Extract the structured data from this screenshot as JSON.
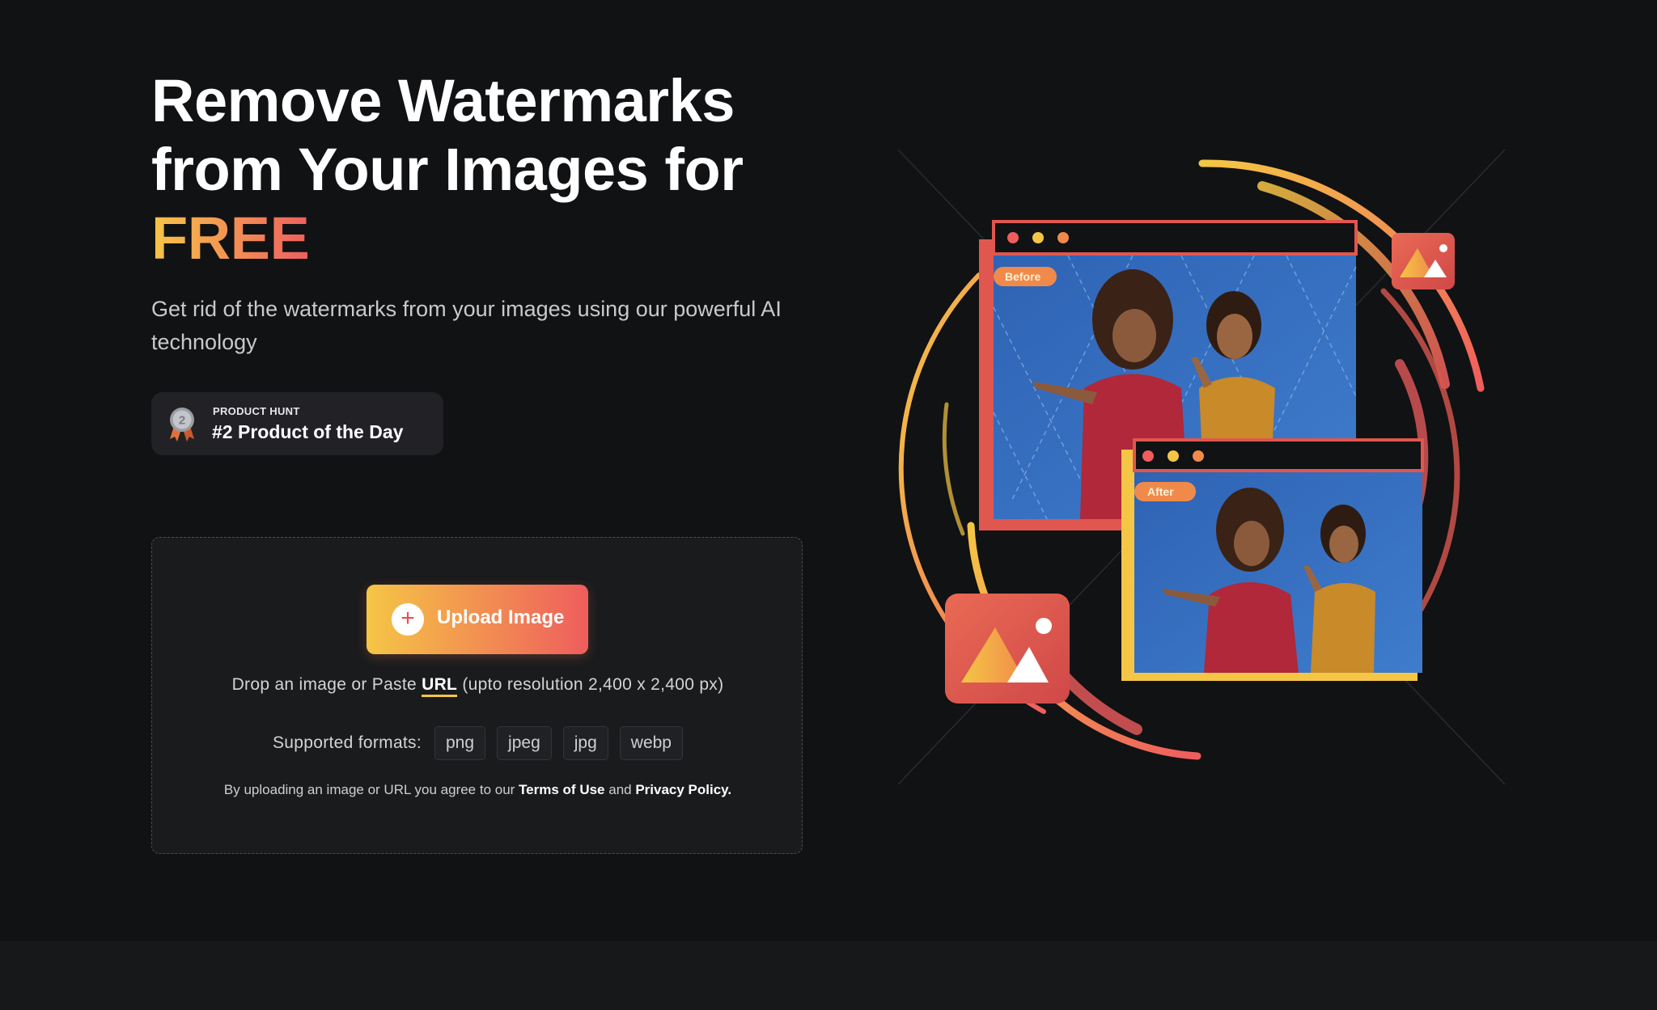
{
  "hero": {
    "title_line1": "Remove Watermarks",
    "title_line2": "from Your Images for",
    "title_highlight": "FREE",
    "subtitle": "Get rid of the watermarks from your images using our powerful AI technology"
  },
  "product_hunt": {
    "kicker": "PRODUCT HUNT",
    "title": "#2 Product of the Day",
    "medal_number": "2"
  },
  "upload": {
    "button_label": "Upload Image",
    "button_icon": "plus-icon",
    "drop_prefix": "Drop an image or Paste ",
    "url_link": "URL",
    "drop_suffix": " (upto resolution 2,400 x 2,400 px)",
    "formats_label": "Supported formats:",
    "formats": [
      "png",
      "jpeg",
      "jpg",
      "webp"
    ],
    "terms_prefix": "By uploading an image or URL you agree to our ",
    "terms_link": "Terms of Use",
    "terms_and": " and ",
    "privacy_link": "Privacy Policy."
  },
  "illustration": {
    "before_label": "Before",
    "after_label": "After"
  },
  "colors": {
    "background": "#111214",
    "accent_start": "#f5c645",
    "accent_end": "#ef5d5d",
    "card": "#1a1b1d"
  }
}
